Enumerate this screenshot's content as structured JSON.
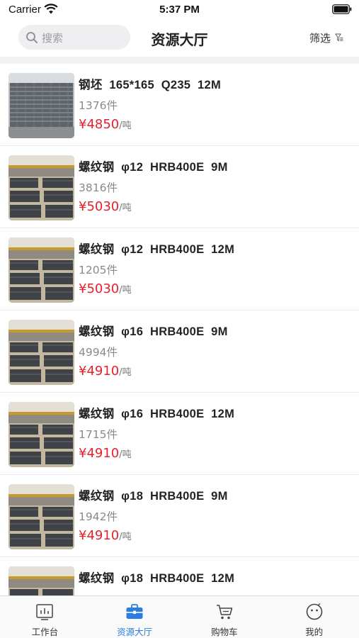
{
  "status_bar": {
    "carrier": "Carrier",
    "time": "5:37 PM"
  },
  "nav": {
    "search_placeholder": "搜索",
    "title": "资源大厅",
    "filter_label": "筛选"
  },
  "colors": {
    "price": "#e8202a",
    "active_tab": "#2b7de0",
    "search_bg": "#efeff2"
  },
  "items": [
    {
      "title": "钢坯  165*165  Q235  12M",
      "qty": "1376件",
      "price": "¥4850",
      "unit": "/吨",
      "image": "steel-billet-stack"
    },
    {
      "title": "螺纹钢  φ12  HRB400E  9M",
      "qty": "3816件",
      "price": "¥5030",
      "unit": "/吨",
      "image": "rebar-warehouse"
    },
    {
      "title": "螺纹钢  φ12  HRB400E  12M",
      "qty": "1205件",
      "price": "¥5030",
      "unit": "/吨",
      "image": "rebar-warehouse"
    },
    {
      "title": "螺纹钢  φ16  HRB400E  9M",
      "qty": "4994件",
      "price": "¥4910",
      "unit": "/吨",
      "image": "rebar-warehouse"
    },
    {
      "title": "螺纹钢  φ16  HRB400E  12M",
      "qty": "1715件",
      "price": "¥4910",
      "unit": "/吨",
      "image": "rebar-warehouse"
    },
    {
      "title": "螺纹钢  φ18  HRB400E  9M",
      "qty": "1942件",
      "price": "¥4910",
      "unit": "/吨",
      "image": "rebar-warehouse"
    },
    {
      "title": "螺纹钢  φ18  HRB400E  12M",
      "qty": "",
      "price": "",
      "unit": "",
      "image": "rebar-warehouse"
    }
  ],
  "tabs": [
    {
      "label": "工作台",
      "icon": "chart-icon",
      "active": false
    },
    {
      "label": "资源大厅",
      "icon": "briefcase-icon",
      "active": true
    },
    {
      "label": "购物车",
      "icon": "cart-icon",
      "active": false
    },
    {
      "label": "我的",
      "icon": "profile-face-icon",
      "active": false
    }
  ]
}
